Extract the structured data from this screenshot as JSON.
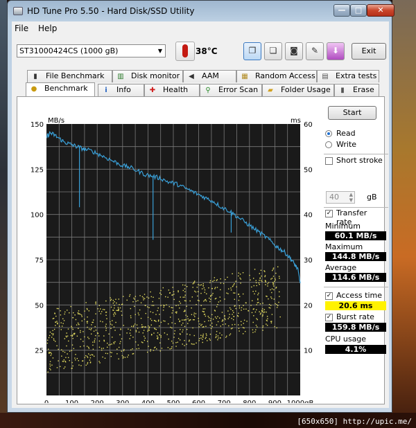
{
  "window": {
    "title": "HD Tune Pro 5.50 - Hard Disk/SSD Utility",
    "caption": {
      "minimize": "—",
      "maximize": "□",
      "close": "✕"
    }
  },
  "menu": {
    "file": "File",
    "help": "Help"
  },
  "toolbar": {
    "drive": "ST31000424CS (1000 gB)",
    "temperature": "38",
    "temperature_unit": "°C",
    "exit_label": "Exit",
    "icons": [
      "copy-icon",
      "copy-info-icon",
      "camera-icon",
      "options-icon",
      "save-icon"
    ]
  },
  "tabs_top": [
    {
      "label": "File Benchmark",
      "icon": "file-benchmark-icon"
    },
    {
      "label": "Disk monitor",
      "icon": "disk-monitor-icon"
    },
    {
      "label": "AAM",
      "icon": "speaker-icon"
    },
    {
      "label": "Random Access",
      "icon": "random-access-icon"
    },
    {
      "label": "Extra tests",
      "icon": "extra-tests-icon"
    }
  ],
  "tabs_bottom": [
    {
      "label": "Benchmark",
      "icon": "benchmark-icon",
      "active": true
    },
    {
      "label": "Info",
      "icon": "info-icon"
    },
    {
      "label": "Health",
      "icon": "health-icon"
    },
    {
      "label": "Error Scan",
      "icon": "magnifier-icon"
    },
    {
      "label": "Folder Usage",
      "icon": "folder-icon"
    },
    {
      "label": "Erase",
      "icon": "erase-icon"
    }
  ],
  "controls": {
    "start_label": "Start",
    "read_label": "Read",
    "write_label": "Write",
    "mode": "read",
    "short_stroke_label": "Short stroke",
    "short_stroke_checked": false,
    "short_stroke_value": "40",
    "short_stroke_unit": "gB",
    "transfer_rate_label": "Transfer rate",
    "transfer_rate_checked": true,
    "access_time_label": "Access time",
    "access_time_checked": true,
    "burst_rate_label": "Burst rate",
    "burst_rate_checked": true
  },
  "results": {
    "minimum_label": "Minimum",
    "minimum": "60.1 MB/s",
    "maximum_label": "Maximum",
    "maximum": "144.8 MB/s",
    "average_label": "Average",
    "average": "114.6 MB/s",
    "access_time": "20.6 ms",
    "burst_rate": "159.8 MB/s",
    "cpu_label": "CPU usage",
    "cpu": "4.1%"
  },
  "watermark": "[650x650] http://upic.me/",
  "chart_data": {
    "type": "line",
    "x_ticks": [
      "0",
      "100",
      "200",
      "300",
      "400",
      "500",
      "600",
      "700",
      "800",
      "900",
      "1000gB"
    ],
    "xlim": [
      0,
      1000
    ],
    "left_axis_label": "MB/s",
    "right_axis_label": "ms",
    "ylim_left": [
      0,
      150
    ],
    "ylim_right": [
      0,
      60
    ],
    "left_ticks": [
      "150",
      "125",
      "100",
      "75",
      "50",
      "25"
    ],
    "right_ticks": [
      "60",
      "50",
      "40",
      "30",
      "20",
      "10"
    ],
    "grid": true,
    "background": "#1a1a1a",
    "grid_color": "#7a7a7a",
    "transfer_color": "#3aa0d8",
    "access_color": "#e8e060",
    "series": [
      {
        "axis": "left",
        "x": [
          0,
          15,
          30,
          50,
          70,
          90,
          110,
          130,
          150,
          180,
          210,
          240,
          270,
          300,
          330,
          360,
          390,
          420,
          450,
          480,
          510,
          540,
          570,
          600,
          630,
          660,
          690,
          720,
          750,
          780,
          810,
          840,
          870,
          900,
          920,
          940,
          960,
          975,
          990,
          1000
        ],
        "y": [
          143,
          145,
          144,
          142,
          140,
          139,
          138,
          137,
          136,
          135,
          133,
          131,
          129,
          127,
          126,
          124,
          122,
          121,
          120,
          118,
          117,
          115,
          113,
          111,
          109,
          107,
          104,
          102,
          99,
          96,
          93,
          90,
          87,
          83,
          81,
          79,
          76,
          73,
          70,
          62
        ]
      },
      {
        "axis": "left",
        "x": [
          130,
          420,
          728
        ],
        "y": [
          104,
          86,
          90
        ]
      }
    ],
    "scatter": {
      "axis": "right",
      "x_range": [
        0,
        1000
      ],
      "min_ms_at_start": 5,
      "max_ms_at_start": 19,
      "min_ms_at_end": 16,
      "max_ms_at_end": 30,
      "count": 900
    }
  }
}
